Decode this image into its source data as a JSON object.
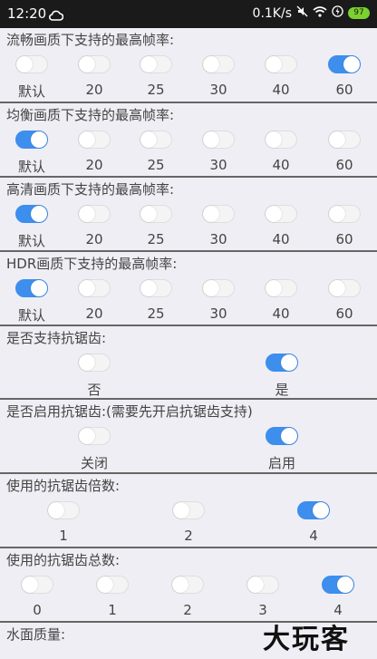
{
  "status_bar": {
    "time": "12:20",
    "speed": "0.1K/s",
    "battery": "97"
  },
  "sections": [
    {
      "title": "流畅画质下支持的最高帧率:",
      "options": [
        {
          "label": "默认",
          "on": false
        },
        {
          "label": "20",
          "on": false
        },
        {
          "label": "25",
          "on": false
        },
        {
          "label": "30",
          "on": false
        },
        {
          "label": "40",
          "on": false
        },
        {
          "label": "60",
          "on": true
        }
      ]
    },
    {
      "title": "均衡画质下支持的最高帧率:",
      "options": [
        {
          "label": "默认",
          "on": true
        },
        {
          "label": "20",
          "on": false
        },
        {
          "label": "25",
          "on": false
        },
        {
          "label": "30",
          "on": false
        },
        {
          "label": "40",
          "on": false
        },
        {
          "label": "60",
          "on": false
        }
      ]
    },
    {
      "title": "高清画质下支持的最高帧率:",
      "options": [
        {
          "label": "默认",
          "on": true
        },
        {
          "label": "20",
          "on": false
        },
        {
          "label": "25",
          "on": false
        },
        {
          "label": "30",
          "on": false
        },
        {
          "label": "40",
          "on": false
        },
        {
          "label": "60",
          "on": false
        }
      ]
    },
    {
      "title": "HDR画质下支持的最高帧率:",
      "options": [
        {
          "label": "默认",
          "on": true
        },
        {
          "label": "20",
          "on": false
        },
        {
          "label": "25",
          "on": false
        },
        {
          "label": "30",
          "on": false
        },
        {
          "label": "40",
          "on": false
        },
        {
          "label": "60",
          "on": false
        }
      ]
    },
    {
      "title": "是否支持抗锯齿:",
      "options": [
        {
          "label": "否",
          "on": false
        },
        {
          "label": "是",
          "on": true
        }
      ]
    },
    {
      "title": "是否启用抗锯齿:(需要先开启抗锯齿支持)",
      "options": [
        {
          "label": "关闭",
          "on": false
        },
        {
          "label": "启用",
          "on": true
        }
      ]
    },
    {
      "title": "使用的抗锯齿倍数:",
      "options": [
        {
          "label": "1",
          "on": false
        },
        {
          "label": "2",
          "on": false
        },
        {
          "label": "4",
          "on": true
        }
      ]
    },
    {
      "title": "使用的抗锯齿总数:",
      "options": [
        {
          "label": "0",
          "on": false
        },
        {
          "label": "1",
          "on": false
        },
        {
          "label": "2",
          "on": false
        },
        {
          "label": "3",
          "on": false
        },
        {
          "label": "4",
          "on": true
        }
      ]
    },
    {
      "title": "水面质量:",
      "options": []
    }
  ],
  "watermark": "大玩客",
  "colors": {
    "accent": "#3d8eed",
    "background": "#efeef4"
  }
}
